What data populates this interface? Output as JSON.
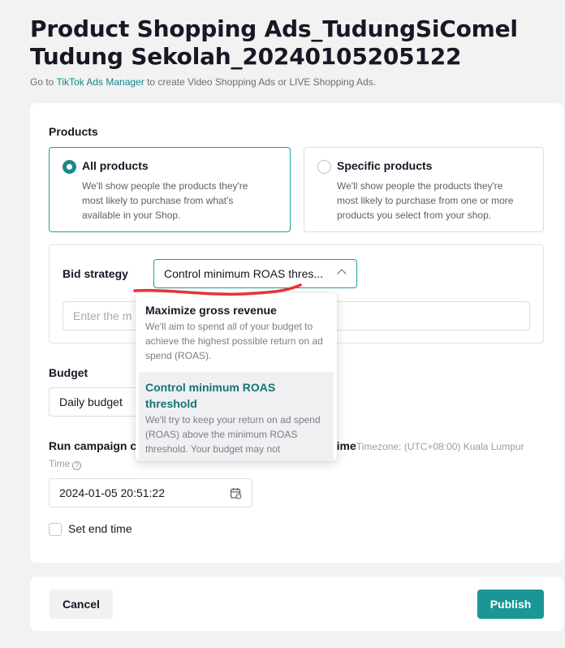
{
  "page": {
    "title": "Product Shopping Ads_TudungSiComel Tudung Sekolah_20240105205122",
    "subtitle_prefix": "Go to ",
    "subtitle_link": "TikTok Ads Manager",
    "subtitle_suffix": " to create Video Shopping Ads or LIVE Shopping Ads."
  },
  "products": {
    "label": "Products",
    "options": [
      {
        "title": "All products",
        "desc": "We'll show people the products they're most likely to purchase from what's available in your Shop.",
        "selected": true
      },
      {
        "title": "Specific products",
        "desc": "We'll show people the products they're most likely to purchase from one or more products you select from your shop.",
        "selected": false
      }
    ]
  },
  "bid": {
    "label": "Bid strategy",
    "selected": "Control minimum ROAS thres...",
    "input_placeholder": "Enter the m",
    "dropdown": [
      {
        "title": "Maximize gross revenue",
        "desc": "We'll aim to spend all of your budget to achieve the highest possible return on ad spend (ROAS)."
      },
      {
        "title": "Control minimum ROAS threshold",
        "desc": "We'll try to keep your return on ad spend (ROAS) above the minimum ROAS threshold. Your budget may not"
      }
    ]
  },
  "budget": {
    "label": "Budget",
    "type": "Daily budget"
  },
  "schedule": {
    "run_label": "Run campaign c",
    "timezone_label": "time",
    "timezone_value": "Timezone: (UTC+08:00) Kuala Lumpur",
    "time_label": "Time",
    "start": "2024-01-05 20:51:22",
    "end_checkbox_label": "Set end time"
  },
  "footer": {
    "cancel": "Cancel",
    "publish": "Publish"
  },
  "colors": {
    "accent": "#1a9696",
    "annotation": "#e8323a"
  }
}
